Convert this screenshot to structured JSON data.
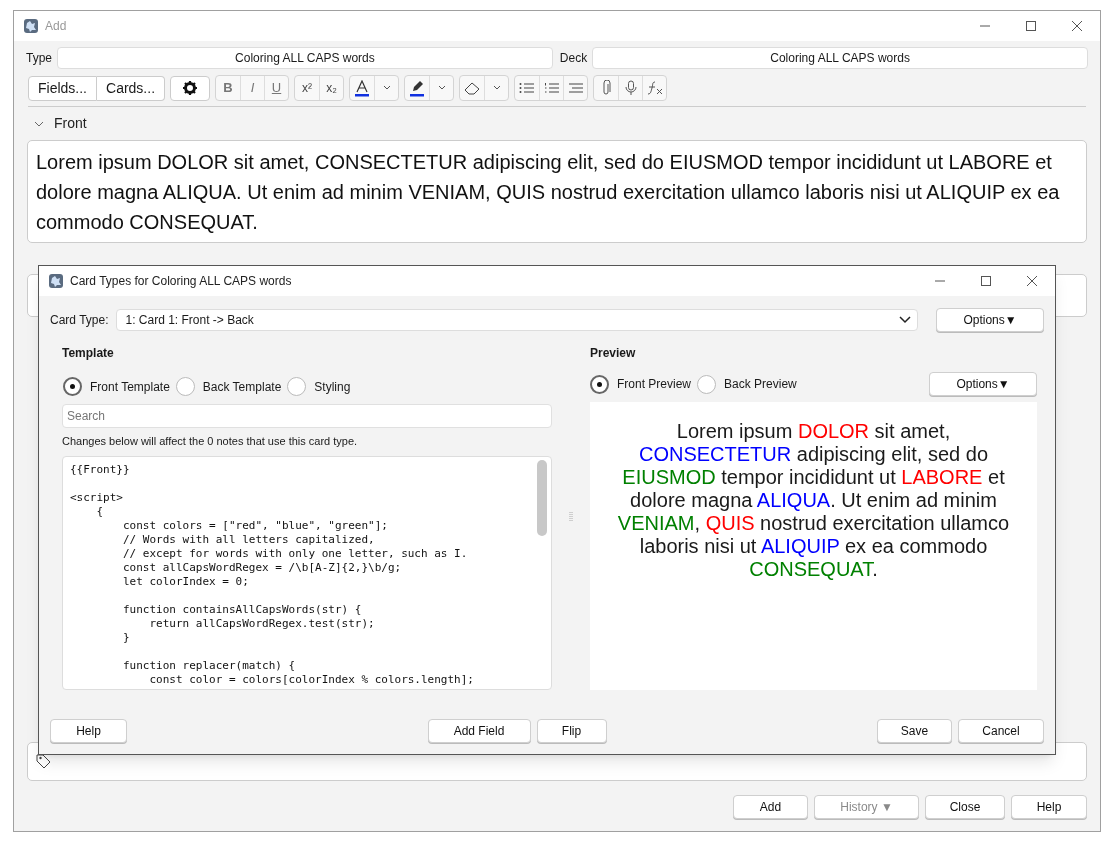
{
  "window": {
    "title": "Add"
  },
  "type_label": "Type",
  "type_value": "Coloring ALL CAPS words",
  "deck_label": "Deck",
  "deck_value": "Coloring ALL CAPS words",
  "toolbar": {
    "fields": "Fields...",
    "cards": "Cards...",
    "format": [
      "B",
      "I",
      "U"
    ],
    "script": [
      "x²",
      "x₂"
    ]
  },
  "front": {
    "label": "Front",
    "text": "Lorem ipsum DOLOR sit amet, CONSECTETUR adipiscing elit, sed do EIUSMOD tempor incididunt ut LABORE et dolore magna ALIQUA. Ut enim ad minim VENIAM, QUIS nostrud exercitation ullamco laboris nisi ut ALIQUIP ex ea commodo CONSEQUAT."
  },
  "buttons": [
    {
      "label": "Add",
      "disabled": false
    },
    {
      "label": "History ▼",
      "disabled": true
    },
    {
      "label": "Close",
      "disabled": false
    },
    {
      "label": "Help",
      "disabled": false
    }
  ],
  "dialog": {
    "title": "Card Types for Coloring ALL CAPS words",
    "card_type_label": "Card Type:",
    "card_type_value": "1: Card 1: Front -> Back",
    "options": "Options▼",
    "template_heading": "Template",
    "template_radios": [
      {
        "label": "Front Template",
        "selected": true
      },
      {
        "label": "Back Template",
        "selected": false
      },
      {
        "label": "Styling",
        "selected": false
      }
    ],
    "search_placeholder": "Search",
    "notice": "Changes below will affect the 0 notes that use this card type.",
    "code": "{{Front}}\n\n<script>\n    {\n        const colors = [\"red\", \"blue\", \"green\"];\n        // Words with all letters capitalized,\n        // except for words with only one letter, such as I.\n        const allCapsWordRegex = /\\b[A-Z]{2,}\\b/g;\n        let colorIndex = 0;\n\n        function containsAllCapsWords(str) {\n            return allCapsWordRegex.test(str);\n        }\n\n        function replacer(match) {\n            const color = colors[colorIndex % colors.length];",
    "preview_heading": "Preview",
    "preview_radios": [
      {
        "label": "Front Preview",
        "selected": true
      },
      {
        "label": "Back Preview",
        "selected": false
      }
    ],
    "preview_options": "Options▼",
    "preview": [
      {
        "text": "Lorem ipsum "
      },
      {
        "text": "DOLOR",
        "color": "#ff0000"
      },
      {
        "text": " sit amet, "
      },
      {
        "text": "CONSECTETUR",
        "color": "#0000ff"
      },
      {
        "text": " adipiscing elit, sed do "
      },
      {
        "text": "EIUSMOD",
        "color": "#008000"
      },
      {
        "text": " tempor incididunt ut "
      },
      {
        "text": "LABORE",
        "color": "#ff0000"
      },
      {
        "text": " et dolore magna "
      },
      {
        "text": "ALIQUA",
        "color": "#0000ff"
      },
      {
        "text": ". Ut enim ad minim "
      },
      {
        "text": "VENIAM",
        "color": "#008000"
      },
      {
        "text": ", "
      },
      {
        "text": "QUIS",
        "color": "#ff0000"
      },
      {
        "text": " nostrud exercitation ullamco laboris nisi ut "
      },
      {
        "text": "ALIQUIP",
        "color": "#0000ff"
      },
      {
        "text": " ex ea commodo "
      },
      {
        "text": "CONSEQUAT",
        "color": "#008000"
      },
      {
        "text": "."
      }
    ],
    "left_buttons": [
      "Help"
    ],
    "center_buttons": [
      "Add Field",
      "Flip"
    ],
    "right_buttons": [
      "Save",
      "Cancel"
    ]
  }
}
